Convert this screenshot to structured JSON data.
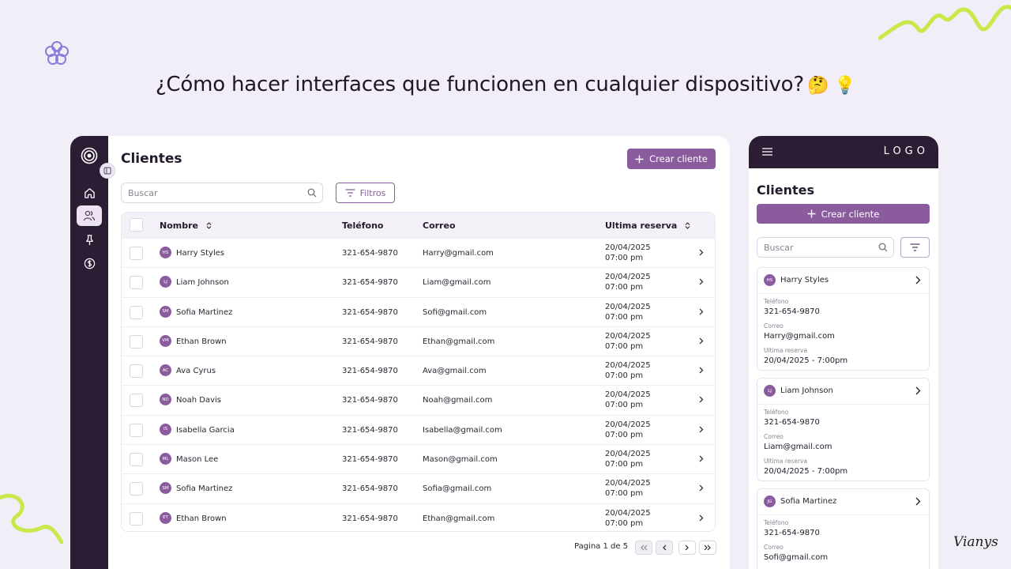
{
  "headline": "¿Cómo hacer interfaces que funcionen en cualquier dispositivo?",
  "headline_emojis": "🤔 💡",
  "signature": "Vianys",
  "colors": {
    "accent": "#8a5c9e",
    "rail": "#2b1d34",
    "background": "#f1eef7",
    "squiggle": "#c9e84a"
  },
  "desktop": {
    "title": "Clientes",
    "create_label": "Crear cliente",
    "search_placeholder": "Buscar",
    "filter_label": "Filtros",
    "nav_icons": [
      "home-icon",
      "users-icon",
      "pin-icon",
      "dollar-icon"
    ],
    "columns": {
      "name": "Nombre",
      "phone": "Teléfono",
      "email": "Correo",
      "last": "Ultima reserva"
    },
    "rows": [
      {
        "initials": "HS",
        "name": "Harry Styles",
        "phone": "321-654-9870",
        "email": "Harry@gmail.com",
        "date": "20/04/2025",
        "time": "07:00 pm"
      },
      {
        "initials": "LJ",
        "name": "Liam Johnson",
        "phone": "321-654-9870",
        "email": "Liam@gmail.com",
        "date": "20/04/2025",
        "time": "07:00 pm"
      },
      {
        "initials": "SM",
        "name": "Sofia Martinez",
        "phone": "321-654-9870",
        "email": "Sofi@gmail.com",
        "date": "20/04/2025",
        "time": "07:00 pm"
      },
      {
        "initials": "VM",
        "name": "Ethan Brown",
        "phone": "321-654-9870",
        "email": "Ethan@gmail.com",
        "date": "20/04/2025",
        "time": "07:00 pm"
      },
      {
        "initials": "AC",
        "name": "Ava Cyrus",
        "phone": "321-654-9870",
        "email": "Ava@gmail.com",
        "date": "20/04/2025",
        "time": "07:00 pm"
      },
      {
        "initials": "ND",
        "name": "Noah Davis",
        "phone": "321-654-9870",
        "email": "Noah@gmail.com",
        "date": "20/04/2025",
        "time": "07:00 pm"
      },
      {
        "initials": "IS",
        "name": "Isabella Garcia",
        "phone": "321-654-9870",
        "email": "Isabella@gmail.com",
        "date": "20/04/2025",
        "time": "07:00 pm"
      },
      {
        "initials": "ML",
        "name": "Mason Lee",
        "phone": "321-654-9870",
        "email": "Mason@gmail.com",
        "date": "20/04/2025",
        "time": "07:00 pm"
      },
      {
        "initials": "SM",
        "name": "Sofia Martinez",
        "phone": "321-654-9870",
        "email": "Sofia@gmail.com",
        "date": "20/04/2025",
        "time": "07:00 pm"
      },
      {
        "initials": "ET",
        "name": "Ethan Brown",
        "phone": "321-654-9870",
        "email": "Ethan@gmail.com",
        "date": "20/04/2025",
        "time": "07:00 pm"
      }
    ],
    "pagination": "Pagina 1 de 5"
  },
  "mobile": {
    "logo": "LOGO",
    "title": "Clientes",
    "create_label": "Crear cliente",
    "search_placeholder": "Buscar",
    "labels": {
      "phone": "Teléfono",
      "email": "Correo",
      "last": "Ultima reserva"
    },
    "cards": [
      {
        "initials": "HS",
        "name": "Harry Styles",
        "phone": "321-654-9870",
        "email": "Harry@gmail.com",
        "last": "20/04/2025 - 7:00pm"
      },
      {
        "initials": "LJ",
        "name": "Liam Johnson",
        "phone": "321-654-9870",
        "email": "Liam@gmail.com",
        "last": "20/04/2025 - 7:00pm"
      },
      {
        "initials": "JG",
        "name": "Sofia Martinez",
        "phone": "321-654-9870",
        "email": "Sofi@gmail.com",
        "last": ""
      }
    ]
  }
}
